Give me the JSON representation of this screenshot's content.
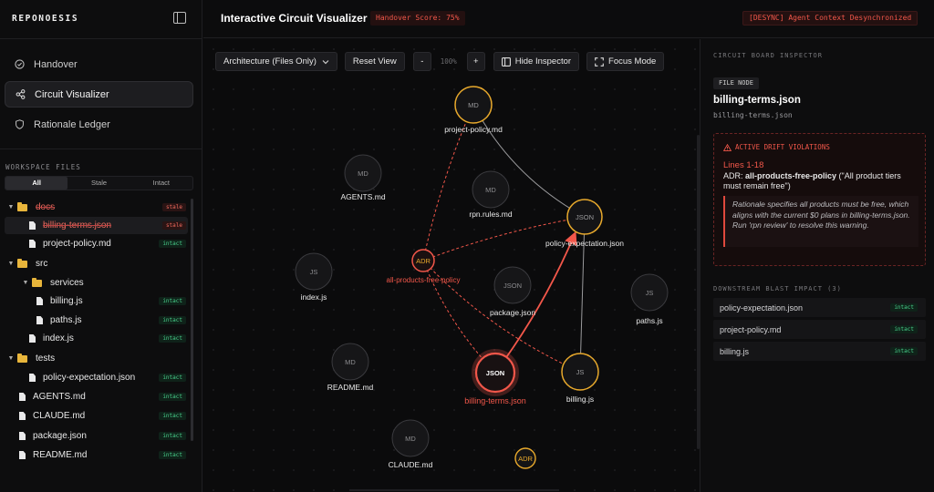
{
  "app": {
    "brand": "REPONOESIS"
  },
  "nav": [
    {
      "label": "Handover",
      "icon": "check-circle-icon"
    },
    {
      "label": "Circuit Visualizer",
      "icon": "share-nodes-icon",
      "active": true
    },
    {
      "label": "Rationale Ledger",
      "icon": "shield-icon"
    }
  ],
  "workspace": {
    "label": "WORKSPACE FILES",
    "filters": [
      "All",
      "Stale",
      "Intact"
    ],
    "active_filter": "All"
  },
  "tree": [
    {
      "type": "folder",
      "name": "docs",
      "badge": "stale",
      "depth": 0,
      "expanded": true
    },
    {
      "type": "file",
      "name": "billing-terms.json",
      "badge": "stale",
      "depth": 1,
      "selected": true
    },
    {
      "type": "file",
      "name": "project-policy.md",
      "badge": "intact",
      "depth": 1
    },
    {
      "type": "folder",
      "name": "src",
      "badge": "",
      "depth": 0,
      "expanded": true
    },
    {
      "type": "folder",
      "name": "services",
      "badge": "",
      "depth": 1,
      "expanded": true
    },
    {
      "type": "file",
      "name": "billing.js",
      "badge": "intact",
      "depth": 2
    },
    {
      "type": "file",
      "name": "paths.js",
      "badge": "intact",
      "depth": 2
    },
    {
      "type": "file",
      "name": "index.js",
      "badge": "intact",
      "depth": 1
    },
    {
      "type": "folder",
      "name": "tests",
      "badge": "",
      "depth": 0,
      "expanded": true
    },
    {
      "type": "file",
      "name": "policy-expectation.json",
      "badge": "intact",
      "depth": 1
    },
    {
      "type": "file",
      "name": "AGENTS.md",
      "badge": "intact",
      "depth": 0
    },
    {
      "type": "file",
      "name": "CLAUDE.md",
      "badge": "intact",
      "depth": 0
    },
    {
      "type": "file",
      "name": "package.json",
      "badge": "intact",
      "depth": 0
    },
    {
      "type": "file",
      "name": "README.md",
      "badge": "intact",
      "depth": 0
    }
  ],
  "header": {
    "title": "Interactive Circuit Visualizer",
    "handover_score": "Handover Score: 75%",
    "desync": "[DESYNC] Agent Context Desynchronized"
  },
  "toolbar": {
    "view_select": "Architecture (Files Only)",
    "reset": "Reset View",
    "zoom_out": "-",
    "zoom": "100%",
    "zoom_in": "+",
    "hide_inspector": "Hide Inspector",
    "focus_mode": "Focus Mode"
  },
  "graph": {
    "nodes": [
      {
        "id": "project-policy",
        "type": "MD",
        "label": "project-policy.md",
        "state": "active"
      },
      {
        "id": "agents",
        "type": "MD",
        "label": "AGENTS.md",
        "state": "dim"
      },
      {
        "id": "rpn-rules",
        "type": "MD",
        "label": "rpn.rules.md",
        "state": "dim"
      },
      {
        "id": "policy-expectation",
        "type": "JSON",
        "label": "policy-expectation.json",
        "state": "active"
      },
      {
        "id": "index",
        "type": "JS",
        "label": "index.js",
        "state": "dim"
      },
      {
        "id": "adr",
        "type": "ADR",
        "label": "all-products-free-policy",
        "state": "adr-active"
      },
      {
        "id": "package",
        "type": "JSON",
        "label": "package.json",
        "state": "dim"
      },
      {
        "id": "paths",
        "type": "JS",
        "label": "paths.js",
        "state": "dim"
      },
      {
        "id": "readme",
        "type": "MD",
        "label": "README.md",
        "state": "dim"
      },
      {
        "id": "billing-terms",
        "type": "JSON",
        "label": "billing-terms.json",
        "state": "selected"
      },
      {
        "id": "billing",
        "type": "JS",
        "label": "billing.js",
        "state": "active"
      },
      {
        "id": "claude",
        "type": "MD",
        "label": "CLAUDE.md",
        "state": "dim"
      },
      {
        "id": "adr2",
        "type": "ADR",
        "label": "",
        "state": "adr"
      }
    ],
    "edges": [
      {
        "from": "project-policy",
        "to": "policy-expectation",
        "style": "solid-gray"
      },
      {
        "from": "policy-expectation",
        "to": "billing",
        "style": "solid-gray"
      },
      {
        "from": "adr",
        "to": "project-policy",
        "style": "dashed-red"
      },
      {
        "from": "adr",
        "to": "policy-expectation",
        "style": "dashed-red"
      },
      {
        "from": "adr",
        "to": "billing-terms",
        "style": "dashed-red"
      },
      {
        "from": "adr",
        "to": "billing",
        "style": "dashed-red"
      },
      {
        "from": "billing-terms",
        "to": "policy-expectation",
        "style": "solid-red-arrow"
      }
    ]
  },
  "inspector": {
    "title": "CIRCUIT BOARD INSPECTOR",
    "kind": "FILE NODE",
    "name": "billing-terms.json",
    "path": "billing-terms.json",
    "drift": {
      "heading": "ACTIVE DRIFT VIOLATIONS",
      "lines": "Lines 1-18",
      "adr_prefix": "ADR: ",
      "adr_name": "all-products-free-policy",
      "adr_quote": " (\"All product tiers must remain free\")",
      "rationale": "Rationale specifies all products must be free, which aligns with the current $0 plans in billing-terms.json. Run 'rpn review' to resolve this warning."
    },
    "blast_title": "DOWNSTREAM BLAST IMPACT (3)",
    "blast": [
      {
        "name": "policy-expectation.json",
        "badge": "intact"
      },
      {
        "name": "project-policy.md",
        "badge": "intact"
      },
      {
        "name": "billing.js",
        "badge": "intact"
      }
    ]
  },
  "colors": {
    "accent_red": "#f2574a",
    "accent_orange": "#e8a92c",
    "intact_green": "#48d08b"
  }
}
